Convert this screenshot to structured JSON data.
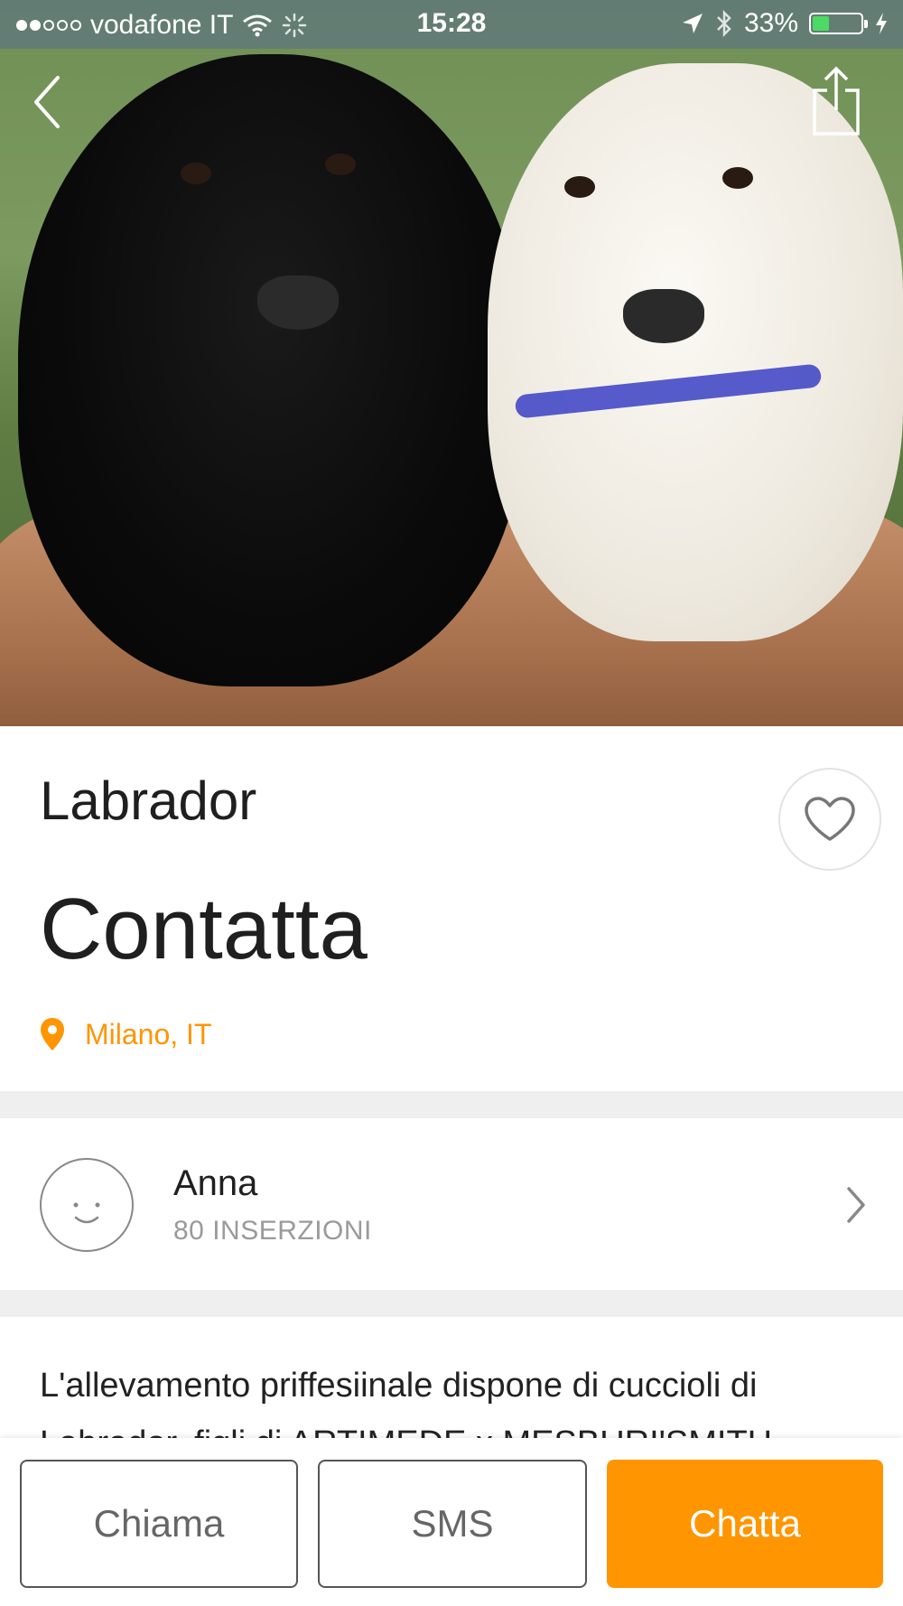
{
  "status_bar": {
    "carrier": "vodafone IT",
    "time": "15:28",
    "battery": "33%",
    "battery_level": 0.33
  },
  "listing": {
    "title": "Labrador",
    "price": "Contatta",
    "location": "Milano, IT"
  },
  "seller": {
    "name": "Anna",
    "listings_count": "80 INSERZIONI"
  },
  "description": {
    "text": "L'allevamento priffesiinale dispone di cuccioli di Labrador, figli di ARTIMEDE x MESBURI'SMITH"
  },
  "actions": {
    "call_label": "Chiama",
    "sms_label": "SMS",
    "chat_label": "Chatta"
  },
  "colors": {
    "accent": "#ff9500",
    "battery_fill": "#4cd964"
  },
  "icons": [
    "back-icon",
    "share-icon",
    "heart-icon",
    "location-pin-icon",
    "avatar-smiley-icon",
    "chevron-right-icon",
    "wifi-icon",
    "location-arrow-icon",
    "bluetooth-icon",
    "charging-icon"
  ]
}
